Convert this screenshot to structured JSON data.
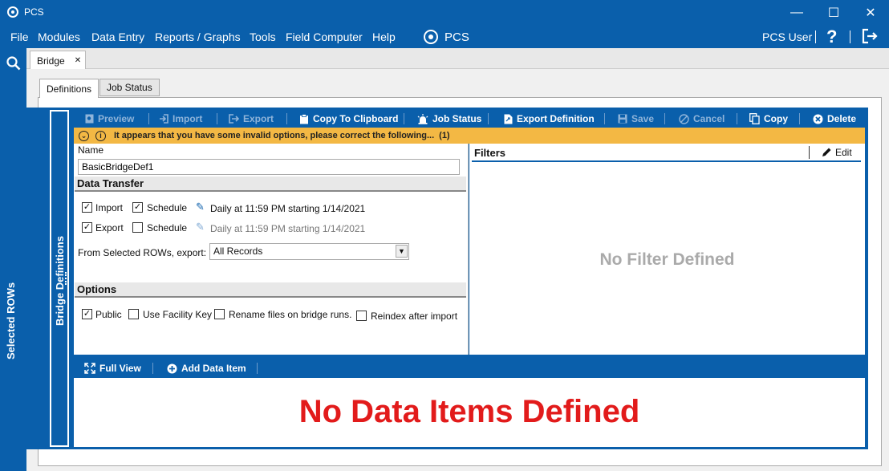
{
  "window": {
    "title": "PCS",
    "controls": {
      "minimize": "—",
      "maximize": "☐",
      "close": "✕"
    }
  },
  "menubar": {
    "items": [
      "File",
      "Modules",
      "Data Entry",
      "Reports / Graphs",
      "Tools",
      "Field Computer",
      "Help"
    ],
    "logo_label": "PCS",
    "user": "PCS User",
    "help_glyph": "?"
  },
  "leftbar": {
    "label": "Selected ROWs"
  },
  "doc_tabs": [
    {
      "label": "Bridge",
      "close": "✕"
    }
  ],
  "sub_tabs": [
    {
      "label": "Definitions",
      "active": true
    },
    {
      "label": "Job Status",
      "active": false
    }
  ],
  "side_panel": {
    "label": "Bridge Definitions"
  },
  "toolbar": {
    "preview": "Preview",
    "import": "Import",
    "export": "Export",
    "copy_to_clipboard": "Copy To Clipboard",
    "job_status": "Job Status",
    "export_definition": "Export Definition",
    "save": "Save",
    "cancel": "Cancel",
    "copy": "Copy",
    "delete": "Delete"
  },
  "warning": {
    "message": "It appears that you have some invalid options, please correct the following...",
    "count": "(1)"
  },
  "form": {
    "name_label": "Name",
    "name_value": "BasicBridgeDef1",
    "data_transfer_header": "Data Transfer",
    "import_label": "Import",
    "import_checked": true,
    "import_schedule_label": "Schedule",
    "import_schedule_checked": true,
    "import_schedule_text": "Daily at 11:59 PM starting 1/14/2021",
    "export_label": "Export",
    "export_checked": true,
    "export_schedule_label": "Schedule",
    "export_schedule_checked": false,
    "export_schedule_text": "Daily at 11:59 PM starting 1/14/2021",
    "from_selected_label": "From Selected ROWs, export:",
    "from_selected_value": "All Records",
    "options_header": "Options",
    "public_label": "Public",
    "public_checked": true,
    "facility_key_label": "Use Facility Key",
    "facility_key_checked": false,
    "rename_files_label": "Rename files on bridge runs.",
    "rename_files_checked": false,
    "reindex_label": "Reindex after import",
    "reindex_checked": false
  },
  "filters": {
    "header": "Filters",
    "edit_label": "Edit",
    "empty_text": "No Filter Defined"
  },
  "bottom_toolbar": {
    "full_view": "Full View",
    "add_data_item": "Add Data Item"
  },
  "data_items": {
    "empty_text": "No Data Items Defined"
  },
  "colors": {
    "accent": "#0a5fab",
    "warning": "#f3b844",
    "error_text": "#e21b1b"
  }
}
